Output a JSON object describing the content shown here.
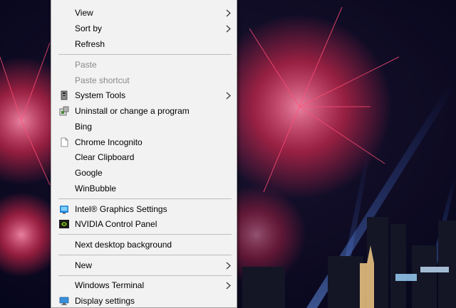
{
  "desktop": {
    "wallpaper": "fireworks-over-city-night",
    "colors": {
      "sky": "#0a0a22",
      "firework_red": "#ff2d55",
      "firework_pink": "#ff7aa0",
      "beam_blue": "#3d7cff"
    }
  },
  "context_menu": {
    "items": [
      {
        "label": "View",
        "submenu": true,
        "enabled": true
      },
      {
        "label": "Sort by",
        "submenu": true,
        "enabled": true
      },
      {
        "label": "Refresh",
        "enabled": true
      },
      {
        "label": "Paste",
        "enabled": false
      },
      {
        "label": "Paste shortcut",
        "enabled": false
      },
      {
        "label": "System Tools",
        "submenu": true,
        "enabled": true,
        "icon": "system-tools-icon"
      },
      {
        "label": "Uninstall or change a program",
        "enabled": true,
        "icon": "programs-icon"
      },
      {
        "label": "Bing",
        "enabled": true
      },
      {
        "label": "Chrome Incognito",
        "enabled": true,
        "icon": "document-icon"
      },
      {
        "label": "Clear Clipboard",
        "enabled": true
      },
      {
        "label": "Google",
        "enabled": true
      },
      {
        "label": "WinBubble",
        "enabled": true
      },
      {
        "label": "Intel® Graphics Settings",
        "enabled": true,
        "icon": "intel-graphics-icon"
      },
      {
        "label": "NVIDIA Control Panel",
        "enabled": true,
        "icon": "nvidia-icon"
      },
      {
        "label": "Next desktop background",
        "enabled": true
      },
      {
        "label": "New",
        "submenu": true,
        "enabled": true
      },
      {
        "label": "Windows Terminal",
        "submenu": true,
        "enabled": true
      },
      {
        "label": "Display settings",
        "enabled": true,
        "icon": "display-settings-icon"
      }
    ]
  }
}
